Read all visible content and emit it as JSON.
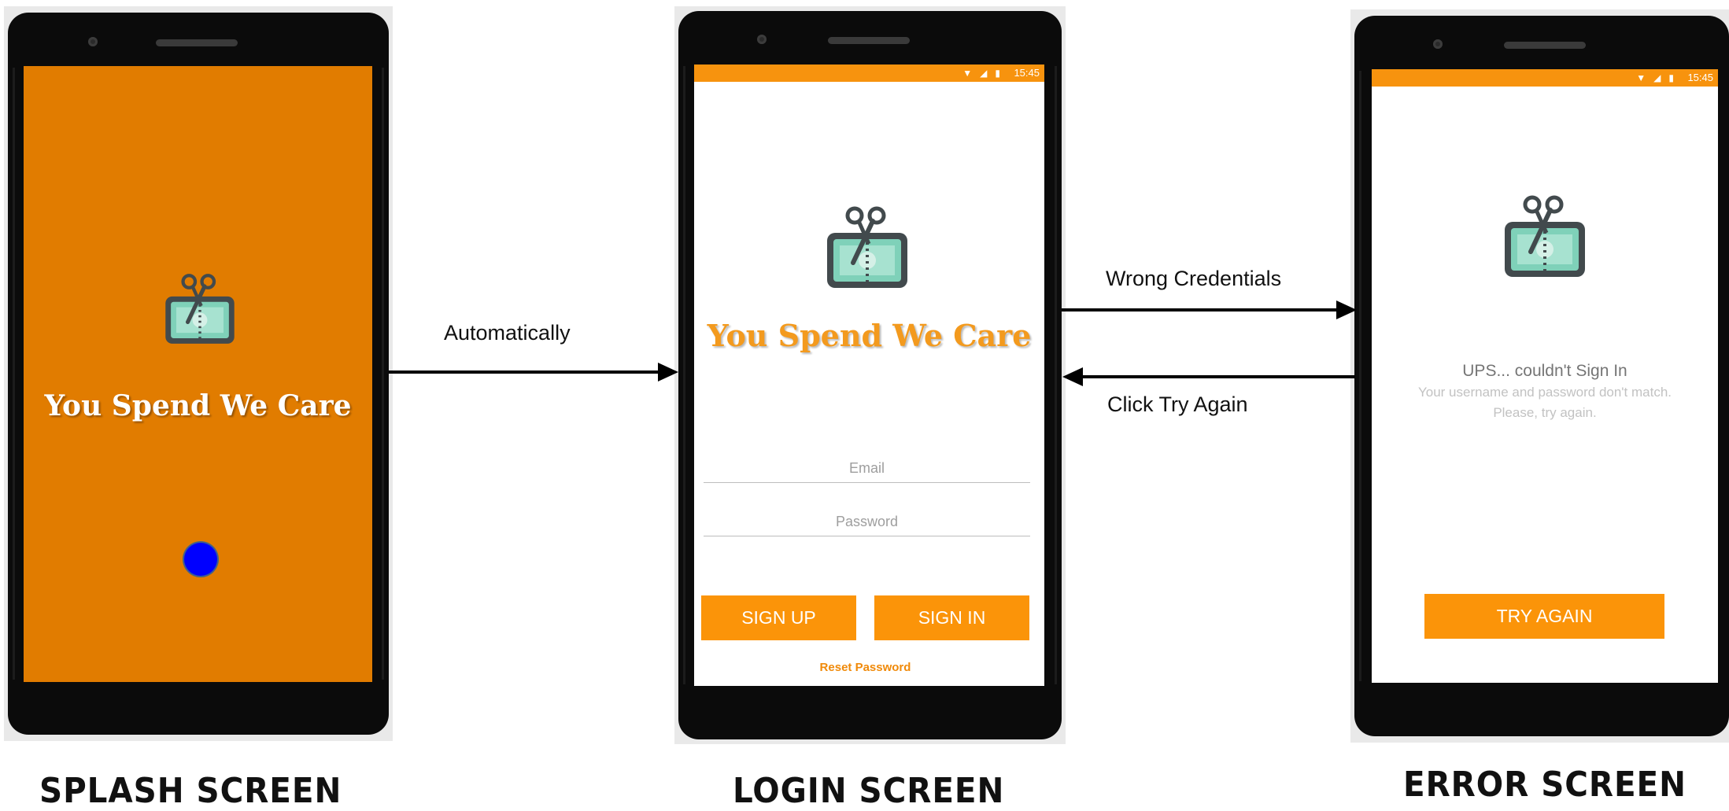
{
  "screens": {
    "splash": {
      "brand": "You Spend We Care",
      "caption": "SPLASH SCREEN",
      "colors": {
        "background": "#e17c00",
        "loader": "#0000ff"
      }
    },
    "login": {
      "status_time": "15:45",
      "brand": "You Spend We Care",
      "email_placeholder": "Email",
      "password_placeholder": "Password",
      "sign_up_label": "SIGN UP",
      "sign_in_label": "SIGN IN",
      "reset_password_label": "Reset Password",
      "caption": "LOGIN SCREEN",
      "colors": {
        "accent": "#fb9409",
        "brand_text": "#f39a1e"
      }
    },
    "error": {
      "status_time": "15:45",
      "title": "UPS... couldn't Sign In",
      "message_line1": "Your username and password don't match.",
      "message_line2": "Please, try again.",
      "try_again_label": "TRY AGAIN",
      "caption": "ERROR SCREEN"
    }
  },
  "transitions": {
    "automatically": "Automatically",
    "wrong_credentials": "Wrong Credentials",
    "click_try_again": "Click Try Again"
  },
  "icons": [
    "app-logo-scissors-bill-icon",
    "wifi-icon",
    "signal-icon",
    "battery-icon",
    "loading-indicator"
  ]
}
